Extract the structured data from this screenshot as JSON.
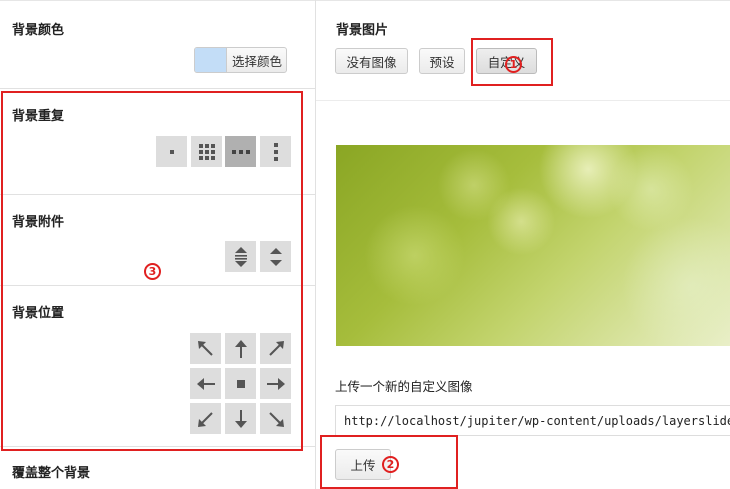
{
  "left": {
    "bg_color": {
      "label": "背景颜色",
      "button": "选择颜色",
      "swatch": "#c3ddf7"
    },
    "bg_repeat": {
      "label": "背景重复",
      "options": [
        "no-repeat-icon",
        "tile-icon",
        "repeat-x-icon",
        "repeat-y-icon"
      ],
      "selected": "repeat-x-icon"
    },
    "bg_attachment": {
      "label": "背景附件",
      "options": [
        "scroll-icon",
        "fixed-icon"
      ]
    },
    "bg_position": {
      "label": "背景位置",
      "options": [
        "top-left",
        "top",
        "top-right",
        "left",
        "center",
        "right",
        "bottom-left",
        "bottom",
        "bottom-right"
      ]
    },
    "bg_cover": {
      "label": "覆盖整个背景"
    }
  },
  "right": {
    "bg_image": {
      "label": "背景图片",
      "buttons": {
        "none": "没有图像",
        "preset": "预设",
        "custom": "自定义"
      }
    },
    "upload": {
      "label": "上传一个新的自定义图像",
      "url": "http://localhost/jupiter/wp-content/uploads/layerslider",
      "button": "上传"
    }
  },
  "annotations": {
    "one": "1",
    "two": "2",
    "three": "3",
    "color": "#e02020"
  }
}
